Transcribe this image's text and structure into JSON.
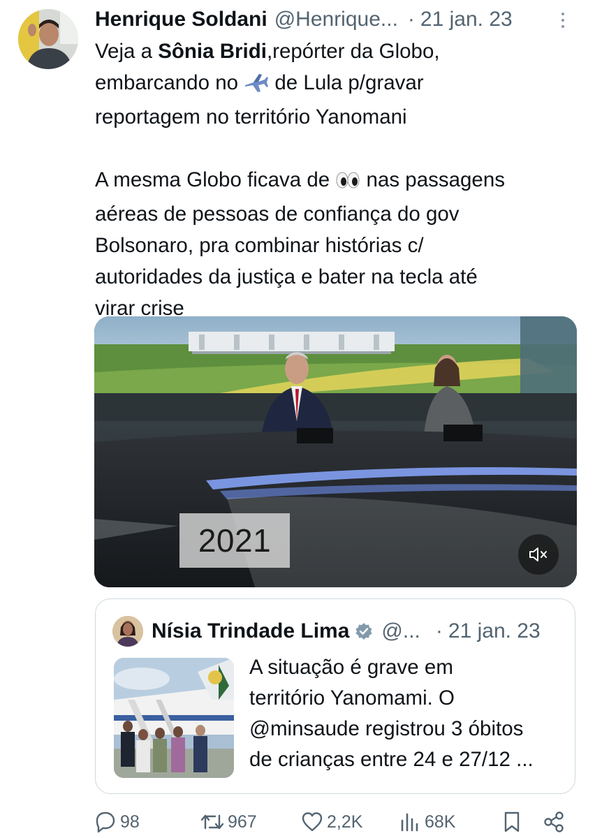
{
  "tweet": {
    "author": {
      "name": "Henrique Soldani",
      "handle": "@Henrique...",
      "date": "21 jan. 23"
    },
    "separator": "·",
    "text_lines": [
      {
        "before": "Veja a ",
        "bold": "Sônia Bridi",
        "after": ",repórter da Globo,"
      },
      {
        "before": "embarcando no ",
        "emoji": "airplane-emoji",
        "after": " de Lula p/gravar"
      },
      {
        "text": "reportagem no território Yanomani"
      }
    ],
    "text_lines_2": [
      {
        "before": "A mesma Globo ficava de ",
        "emoji": "eyes-emoji",
        "after": " nas passagens"
      },
      {
        "text": "aéreas de pessoas de confiança do gov"
      },
      {
        "text": "Bolsonaro, pra combinar histórias c/"
      },
      {
        "text": "autoridades da justiça e bater na tecla até"
      },
      {
        "text": "virar crise"
      }
    ]
  },
  "media": {
    "year_badge": "2021",
    "mute_icon": "speaker-muted-icon"
  },
  "quoted_tweet": {
    "name": "Nísia Trindade Lima",
    "verified_icon": "verified-badge-icon",
    "handle": "@...",
    "separator": "·",
    "date": "21 jan. 23",
    "lines": [
      "A situação é grave em",
      "território Yanomami. O",
      "@minsaude registrou 3 óbitos",
      "de crianças entre 24 e 27/12 ..."
    ]
  },
  "actions": {
    "replies": "98",
    "retweets": "967",
    "likes": "2,2K",
    "views": "68K",
    "icons": [
      "reply-icon",
      "retweet-icon",
      "like-icon",
      "views-icon",
      "bookmark-icon",
      "share-icon"
    ]
  },
  "colors": {
    "text": "#0f1419",
    "secondary": "#536471",
    "border": "#cfd9de",
    "verified": "#829aab"
  }
}
